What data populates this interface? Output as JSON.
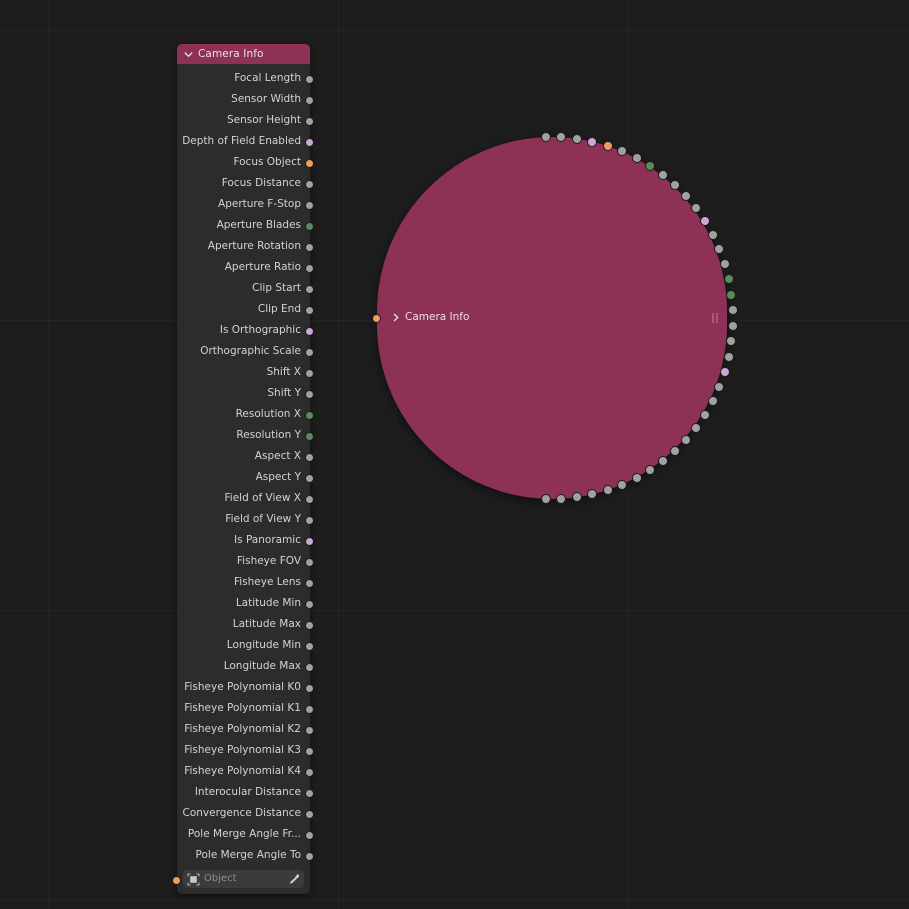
{
  "editor": {
    "name": "blender-node-editor",
    "background_color": "#1d1d1d"
  },
  "socket_colors": {
    "value": "#a1a1a1",
    "integer": "#598c5c",
    "boolean": "#cca6d6",
    "object": "#ed9e5c"
  },
  "node": {
    "title": "Camera Info",
    "header_color": "#8e3157",
    "body_color": "#2c2c2c",
    "collapse_icon": "chevron-down-icon",
    "outputs": [
      {
        "label": "Focal Length",
        "type": "value"
      },
      {
        "label": "Sensor Width",
        "type": "value"
      },
      {
        "label": "Sensor Height",
        "type": "value"
      },
      {
        "label": "Depth of Field Enabled",
        "type": "boolean"
      },
      {
        "label": "Focus Object",
        "type": "object"
      },
      {
        "label": "Focus Distance",
        "type": "value"
      },
      {
        "label": "Aperture F-Stop",
        "type": "value"
      },
      {
        "label": "Aperture Blades",
        "type": "integer"
      },
      {
        "label": "Aperture Rotation",
        "type": "value"
      },
      {
        "label": "Aperture Ratio",
        "type": "value"
      },
      {
        "label": "Clip Start",
        "type": "value"
      },
      {
        "label": "Clip End",
        "type": "value"
      },
      {
        "label": "Is Orthographic",
        "type": "boolean"
      },
      {
        "label": "Orthographic Scale",
        "type": "value"
      },
      {
        "label": "Shift X",
        "type": "value"
      },
      {
        "label": "Shift Y",
        "type": "value"
      },
      {
        "label": "Resolution X",
        "type": "integer"
      },
      {
        "label": "Resolution Y",
        "type": "integer"
      },
      {
        "label": "Aspect X",
        "type": "value"
      },
      {
        "label": "Aspect Y",
        "type": "value"
      },
      {
        "label": "Field of View X",
        "type": "value"
      },
      {
        "label": "Field of View Y",
        "type": "value"
      },
      {
        "label": "Is Panoramic",
        "type": "boolean"
      },
      {
        "label": "Fisheye FOV",
        "type": "value"
      },
      {
        "label": "Fisheye Lens",
        "type": "value"
      },
      {
        "label": "Latitude Min",
        "type": "value"
      },
      {
        "label": "Latitude Max",
        "type": "value"
      },
      {
        "label": "Longitude Min",
        "type": "value"
      },
      {
        "label": "Longitude Max",
        "type": "value"
      },
      {
        "label": "Fisheye Polynomial K0",
        "type": "value"
      },
      {
        "label": "Fisheye Polynomial K1",
        "type": "value"
      },
      {
        "label": "Fisheye Polynomial K2",
        "type": "value"
      },
      {
        "label": "Fisheye Polynomial K3",
        "type": "value"
      },
      {
        "label": "Fisheye Polynomial K4",
        "type": "value"
      },
      {
        "label": "Interocular Distance",
        "type": "value"
      },
      {
        "label": "Convergence Distance",
        "type": "value"
      },
      {
        "label": "Pole Merge Angle Fr...",
        "type": "value"
      },
      {
        "label": "Pole Merge Angle To",
        "type": "value"
      }
    ],
    "object_input": {
      "socket_type": "object",
      "icon": "object-icon",
      "value": "",
      "placeholder": "Object",
      "picker_icon": "eyedropper-icon"
    }
  },
  "collapsed_node": {
    "title": "Camera Info",
    "header_color": "#8e3157",
    "expand_icon": "chevron-right-icon",
    "resize_grip_icon": "grip-handle-icon",
    "input_socket_type": "object"
  }
}
